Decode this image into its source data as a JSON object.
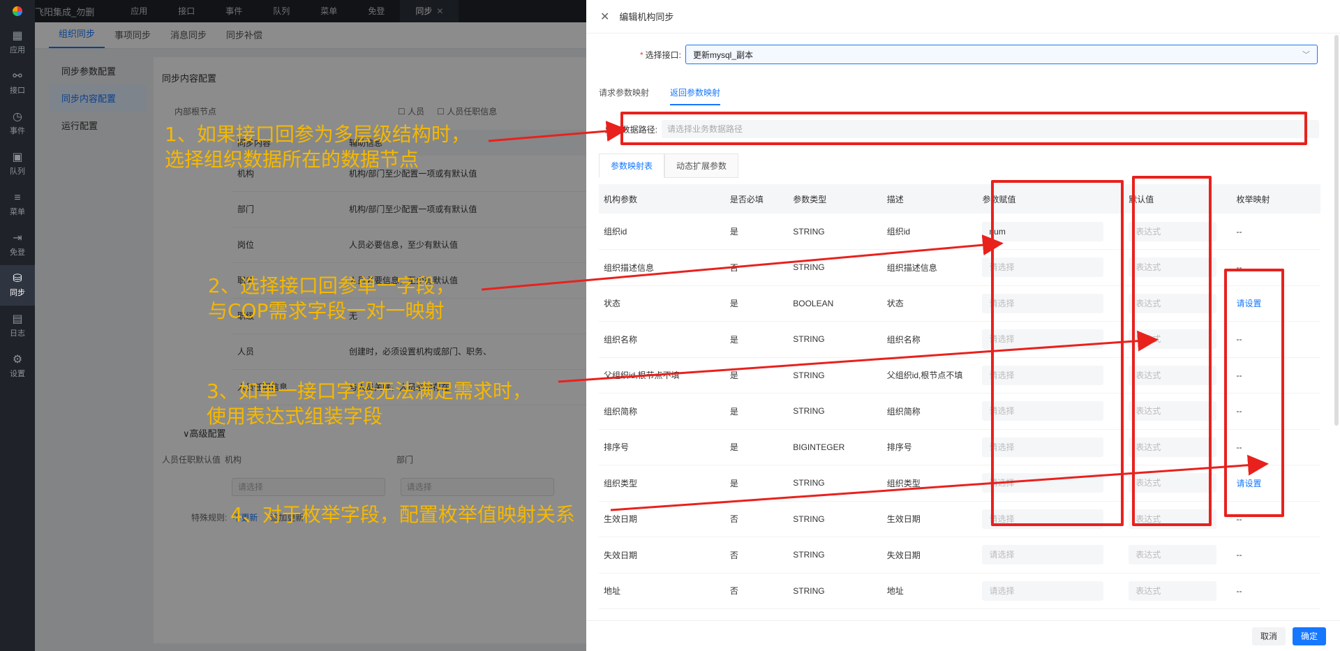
{
  "topbar": {
    "app_title": "飞阳集成_勿删",
    "nav": [
      "应用",
      "接口",
      "事件",
      "队列",
      "菜单",
      "免登",
      "同步"
    ],
    "active_tab_close": "✕"
  },
  "rail": [
    {
      "label": "应用",
      "icon": "▦"
    },
    {
      "label": "接口",
      "icon": "⚯"
    },
    {
      "label": "事件",
      "icon": "◷"
    },
    {
      "label": "队列",
      "icon": "▣"
    },
    {
      "label": "菜单",
      "icon": "≡"
    },
    {
      "label": "免登",
      "icon": "⇥"
    },
    {
      "label": "同步",
      "icon": "⛁"
    },
    {
      "label": "日志",
      "icon": "▤"
    },
    {
      "label": "设置",
      "icon": "⚙"
    }
  ],
  "bg": {
    "tabs": [
      "组织同步",
      "事项同步",
      "消息同步",
      "同步补偿"
    ],
    "side": [
      "同步参数配置",
      "同步内容配置",
      "运行配置"
    ],
    "heading": "同步内容配置",
    "root_label": "内部根节点",
    "checks": [
      "人员",
      "人员任职信息"
    ],
    "headers": [
      "同步内容",
      "辅助信息"
    ],
    "rows": [
      [
        "机构",
        "机构/部门至少配置一项或有默认值"
      ],
      [
        "部门",
        "机构/部门至少配置一项或有默认值"
      ],
      [
        "岗位",
        "人员必要信息，至少有默认值"
      ],
      [
        "职务",
        "人员必要信息，至少有默认值"
      ],
      [
        "职级",
        "无"
      ],
      [
        "人员",
        "创建时，必须设置机构或部门、职务、"
      ],
      [
        "人员任职信息",
        "与人员关联，人员必须存在"
      ]
    ],
    "advanced": "高级配置",
    "default_label": "人员任职默认值",
    "default_cols": [
      "机构",
      "部门"
    ],
    "select_placeholder": "请选择",
    "special_label": "特殊规则:",
    "special_opts": [
      "不更新",
      "追加更新"
    ]
  },
  "drawer": {
    "title": "编辑机构同步",
    "interface_label": "选择接口:",
    "interface_value": "更新mysql_副本",
    "tabs": [
      "请求参数映射",
      "返回参数映射"
    ],
    "path_label": "业务数据路径:",
    "path_placeholder": "请选择业务数据路径",
    "subtabs": [
      "参数映射表",
      "动态扩展参数"
    ],
    "columns": [
      "机构参数",
      "是否必填",
      "参数类型",
      "描述",
      "参数赋值",
      "默认值",
      "枚举映射"
    ],
    "rows": [
      {
        "name": "组织id",
        "req": "是",
        "type": "STRING",
        "desc": "组织id",
        "value": "num",
        "enum": "--"
      },
      {
        "name": "组织描述信息",
        "req": "否",
        "type": "STRING",
        "desc": "组织描述信息",
        "value": "",
        "enum": "--"
      },
      {
        "name": "状态",
        "req": "是",
        "type": "BOOLEAN",
        "desc": "状态",
        "value": "",
        "enum": "请设置"
      },
      {
        "name": "组织名称",
        "req": "是",
        "type": "STRING",
        "desc": "组织名称",
        "value": "",
        "enum": "--"
      },
      {
        "name": "父组织id,根节点不填",
        "req": "是",
        "type": "STRING",
        "desc": "父组织id,根节点不填",
        "value": "",
        "enum": "--"
      },
      {
        "name": "组织简称",
        "req": "是",
        "type": "STRING",
        "desc": "组织简称",
        "value": "",
        "enum": "--"
      },
      {
        "name": "排序号",
        "req": "是",
        "type": "BIGINTEGER",
        "desc": "排序号",
        "value": "",
        "enum": "--"
      },
      {
        "name": "组织类型",
        "req": "是",
        "type": "STRING",
        "desc": "组织类型",
        "value": "",
        "enum": "请设置"
      },
      {
        "name": "生效日期",
        "req": "否",
        "type": "STRING",
        "desc": "生效日期",
        "value": "",
        "enum": "--"
      },
      {
        "name": "失效日期",
        "req": "否",
        "type": "STRING",
        "desc": "失效日期",
        "value": "",
        "enum": "--"
      },
      {
        "name": "地址",
        "req": "否",
        "type": "STRING",
        "desc": "地址",
        "value": "",
        "enum": "--"
      }
    ],
    "value_placeholder": "请选择",
    "default_placeholder": "表达式",
    "cancel": "取消",
    "ok": "确定"
  },
  "notes": [
    [
      "1、如果接口回参为多层级结构时，",
      "选择组织数据所在的数据节点"
    ],
    [
      "2、选择接口回参单一字段，",
      "与COP需求字段一对一映射"
    ],
    [
      "3、如单一接口字段无法满足需求时，",
      "使用表达式组装字段"
    ],
    [
      "4、对于枚举字段，配置枚举值映射关系"
    ]
  ],
  "colors": {
    "annotation": "#f5b800",
    "highlight": "#e8211d",
    "accent": "#1677ff"
  }
}
